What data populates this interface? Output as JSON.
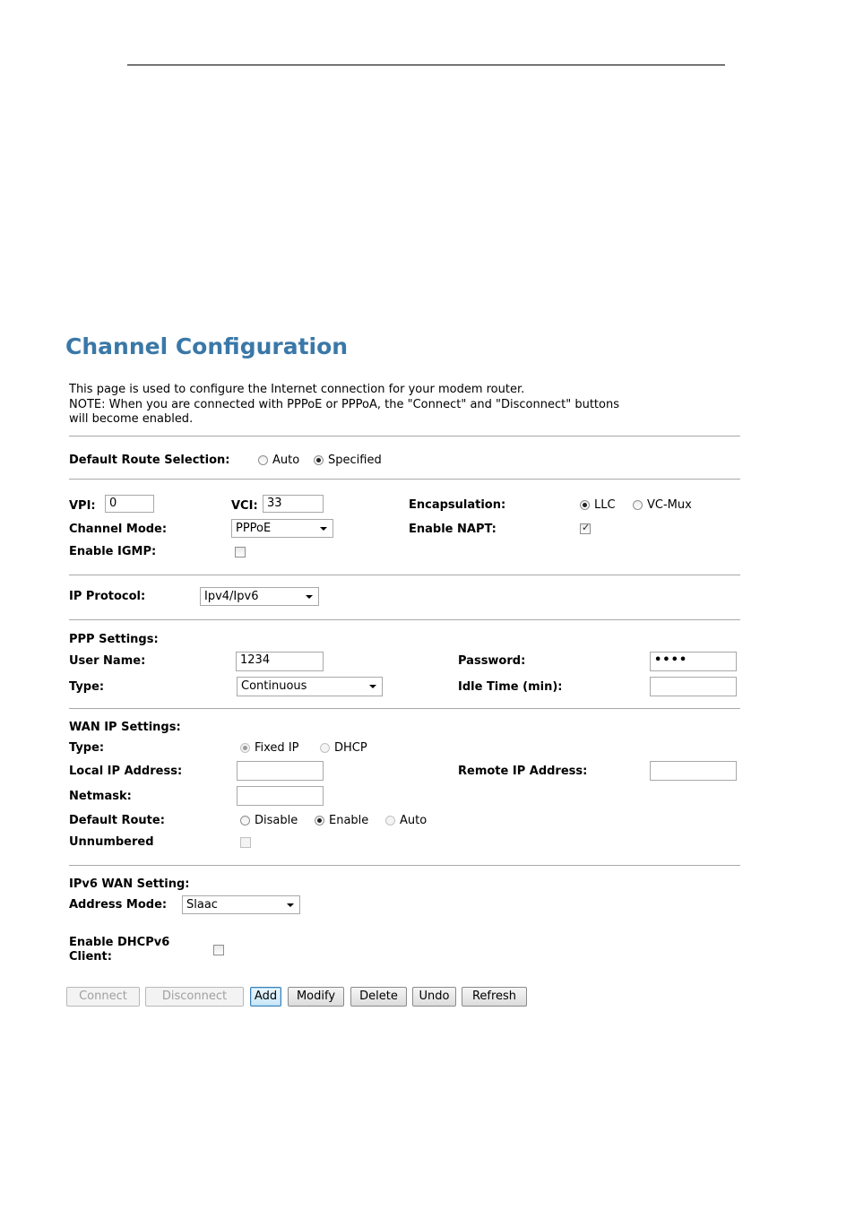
{
  "page": {
    "title": "Channel Configuration",
    "description_lines": [
      "This page is used to configure the Internet connection for your modem router.",
      "NOTE: When you are connected with PPPoE or PPPoA, the \"Connect\" and \"Disconnect\" buttons",
      "will become enabled."
    ]
  },
  "default_route_selection": {
    "label": "Default Route Selection:",
    "options": [
      "Auto",
      "Specified"
    ],
    "selected": "Specified"
  },
  "channel": {
    "vpi_label": "VPI:",
    "vpi_value": "0",
    "vci_label": "VCI:",
    "vci_value": "33",
    "encapsulation_label": "Encapsulation:",
    "encapsulation_options": [
      "LLC",
      "VC-Mux"
    ],
    "encapsulation_selected": "LLC",
    "channel_mode_label": "Channel Mode:",
    "channel_mode_value": "PPPoE",
    "enable_napt_label": "Enable NAPT:",
    "enable_napt_checked": true,
    "enable_igmp_label": "Enable IGMP:",
    "enable_igmp_checked": false
  },
  "ip_protocol": {
    "label": "IP Protocol:",
    "value": "Ipv4/Ipv6"
  },
  "ppp": {
    "heading": "PPP Settings:",
    "user_name_label": "User Name:",
    "user_name_value": "1234",
    "password_label": "Password:",
    "password_value": "••••",
    "type_label": "Type:",
    "type_value": "Continuous",
    "idle_time_label": "Idle Time (min):",
    "idle_time_value": ""
  },
  "wan_ip": {
    "heading": "WAN IP Settings:",
    "type_label": "Type:",
    "type_options": [
      "Fixed IP",
      "DHCP"
    ],
    "type_selected": "Fixed IP",
    "local_ip_label": "Local IP Address:",
    "local_ip_value": "",
    "remote_ip_label": "Remote IP Address:",
    "remote_ip_value": "",
    "netmask_label": "Netmask:",
    "netmask_value": "",
    "default_route_label": "Default Route:",
    "default_route_options": [
      "Disable",
      "Enable",
      "Auto"
    ],
    "default_route_selected": "Enable",
    "unnumbered_label": "Unnumbered",
    "unnumbered_checked": false
  },
  "ipv6_wan": {
    "heading": "IPv6 WAN Setting:",
    "address_mode_label": "Address Mode:",
    "address_mode_value": "Slaac",
    "dhcpv6_label_line1": "Enable DHCPv6",
    "dhcpv6_label_line2": "Client:",
    "dhcpv6_checked": false
  },
  "buttons": {
    "connect": "Connect",
    "disconnect": "Disconnect",
    "add": "Add",
    "modify": "Modify",
    "delete": "Delete",
    "undo": "Undo",
    "refresh": "Refresh"
  }
}
